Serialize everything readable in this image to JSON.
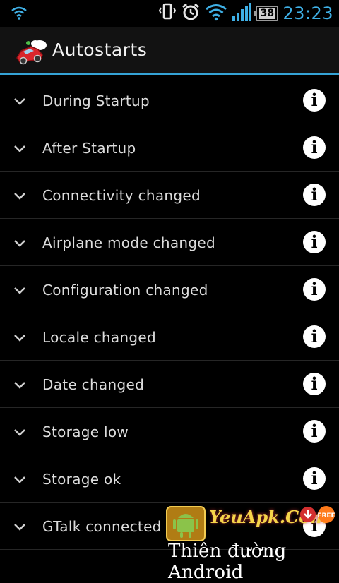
{
  "status_bar": {
    "time": "23:23",
    "battery_level": "38",
    "icons": [
      "wifi-icon",
      "vibrate-icon",
      "alarm-icon",
      "wifi-icon",
      "signal-icon",
      "battery-icon"
    ]
  },
  "action_bar": {
    "title": "Autostarts",
    "app_icon": "car-icon"
  },
  "colors": {
    "accent": "#35a3d6",
    "time": "#3fb0e6",
    "background": "#000000"
  },
  "events": [
    {
      "label": "During Startup"
    },
    {
      "label": "After Startup"
    },
    {
      "label": "Connectivity changed"
    },
    {
      "label": "Airplane mode changed"
    },
    {
      "label": "Configuration changed"
    },
    {
      "label": "Locale changed"
    },
    {
      "label": "Date changed"
    },
    {
      "label": "Storage low"
    },
    {
      "label": "Storage ok"
    },
    {
      "label": "GTalk connected"
    }
  ],
  "watermark": {
    "brand": "YeuApk.Com",
    "tagline": "Thiên đường Android",
    "badge": "FREE"
  }
}
